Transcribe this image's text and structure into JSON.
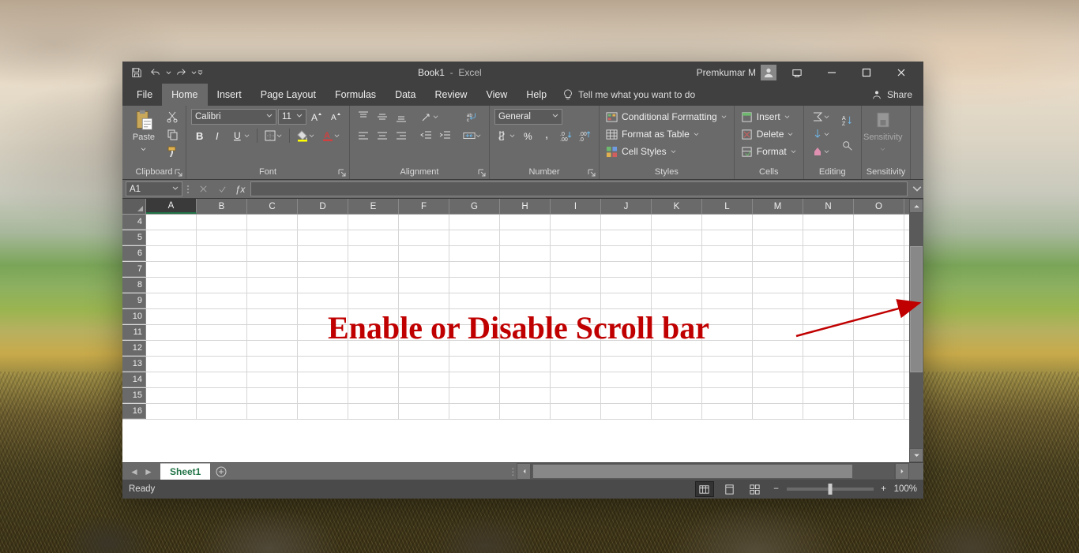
{
  "annotation": {
    "text": "Enable or Disable Scroll bar"
  },
  "titlebar": {
    "doc": "Book1",
    "app": "Excel",
    "user": "Premkumar M"
  },
  "tabs": {
    "file": "File",
    "home": "Home",
    "insert": "Insert",
    "pagelayout": "Page Layout",
    "formulas": "Formulas",
    "data": "Data",
    "review": "Review",
    "view": "View",
    "help": "Help",
    "tellme": "Tell me what you want to do",
    "share": "Share"
  },
  "ribbon": {
    "clipboard": {
      "label": "Clipboard",
      "paste": "Paste"
    },
    "font": {
      "label": "Font",
      "family": "Calibri",
      "size": "11"
    },
    "alignment": {
      "label": "Alignment"
    },
    "number": {
      "label": "Number",
      "format": "General"
    },
    "styles": {
      "label": "Styles",
      "cf": "Conditional Formatting",
      "ft": "Format as Table",
      "cs": "Cell Styles"
    },
    "cells": {
      "label": "Cells",
      "insert": "Insert",
      "delete": "Delete",
      "format": "Format"
    },
    "editing": {
      "label": "Editing"
    },
    "sensitivity": {
      "label": "Sensitivity",
      "btn": "Sensitivity"
    }
  },
  "formula": {
    "cell": "A1",
    "value": ""
  },
  "grid": {
    "columns": [
      "A",
      "B",
      "C",
      "D",
      "E",
      "F",
      "G",
      "H",
      "I",
      "J",
      "K",
      "L",
      "M",
      "N",
      "O"
    ],
    "rowStart": 4,
    "rowEnd": 16,
    "selectedCol": "A"
  },
  "sheets": {
    "active": "Sheet1"
  },
  "status": {
    "ready": "Ready",
    "zoom": "100%"
  }
}
